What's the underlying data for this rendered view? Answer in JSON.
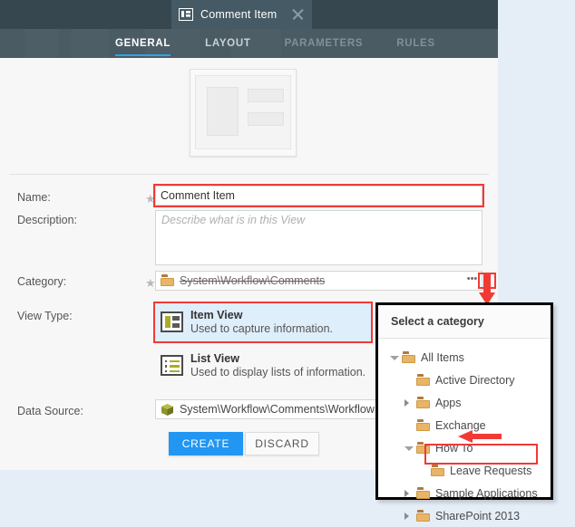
{
  "window": {
    "tab": {
      "title": "Comment Item",
      "icon": "item-view-icon",
      "close_icon": "close-icon"
    },
    "nav_tabs": [
      {
        "label": "GENERAL",
        "state": "active"
      },
      {
        "label": "LAYOUT",
        "state": "inactive"
      },
      {
        "label": "PARAMETERS",
        "state": "dim"
      },
      {
        "label": "RULES",
        "state": "dim"
      }
    ]
  },
  "form": {
    "name": {
      "label": "Name:",
      "required_marker": "★",
      "value": "Comment Item"
    },
    "description": {
      "label": "Description:",
      "value": "",
      "placeholder": "Describe what is in this View"
    },
    "category": {
      "label": "Category:",
      "required_marker": "★",
      "value": "System\\Workflow\\Comments",
      "browse_label": "•••",
      "icon": "folder-icon"
    },
    "view_type": {
      "label": "View Type:",
      "options": [
        {
          "title": "Item View",
          "description": "Used to capture information.",
          "icon": "item-view-icon",
          "selected": true
        },
        {
          "title": "List View",
          "description": "Used to display lists of information.",
          "icon": "list-view-icon",
          "selected": false
        }
      ]
    },
    "data_source": {
      "label": "Data Source:",
      "value": "System\\Workflow\\Comments\\Workflow Co",
      "icon": "smartobject-icon"
    },
    "buttons": {
      "create": "CREATE",
      "discard": "DISCARD"
    }
  },
  "category_popup": {
    "title": "Select a category",
    "tree": [
      {
        "label": "All Items",
        "depth": 0,
        "twisty": "expanded",
        "icon": "folder-icon"
      },
      {
        "label": "Active Directory",
        "depth": 1,
        "twisty": "none",
        "icon": "folder-icon"
      },
      {
        "label": "Apps",
        "depth": 1,
        "twisty": "collapsed",
        "icon": "folder-icon"
      },
      {
        "label": "Exchange",
        "depth": 1,
        "twisty": "none",
        "icon": "folder-icon"
      },
      {
        "label": "How To",
        "depth": 1,
        "twisty": "expanded",
        "icon": "folder-icon"
      },
      {
        "label": "Leave Requests",
        "depth": 2,
        "twisty": "none",
        "icon": "folder-icon"
      },
      {
        "label": "Sample Applications",
        "depth": 1,
        "twisty": "collapsed",
        "icon": "folder-icon"
      },
      {
        "label": "SharePoint 2013",
        "depth": 1,
        "twisty": "collapsed",
        "icon": "folder-icon"
      }
    ]
  },
  "annotations": {
    "highlight_color": "#f23a35",
    "arrow_down": "red-down-arrow",
    "arrow_left": "red-left-arrow"
  },
  "colors": {
    "accent_blue": "#2196f3",
    "tab_strip": "#37474f",
    "nav_bar": "#4a5b63",
    "selected_row": "#dfeefb",
    "page_background": "#e5edf7"
  }
}
